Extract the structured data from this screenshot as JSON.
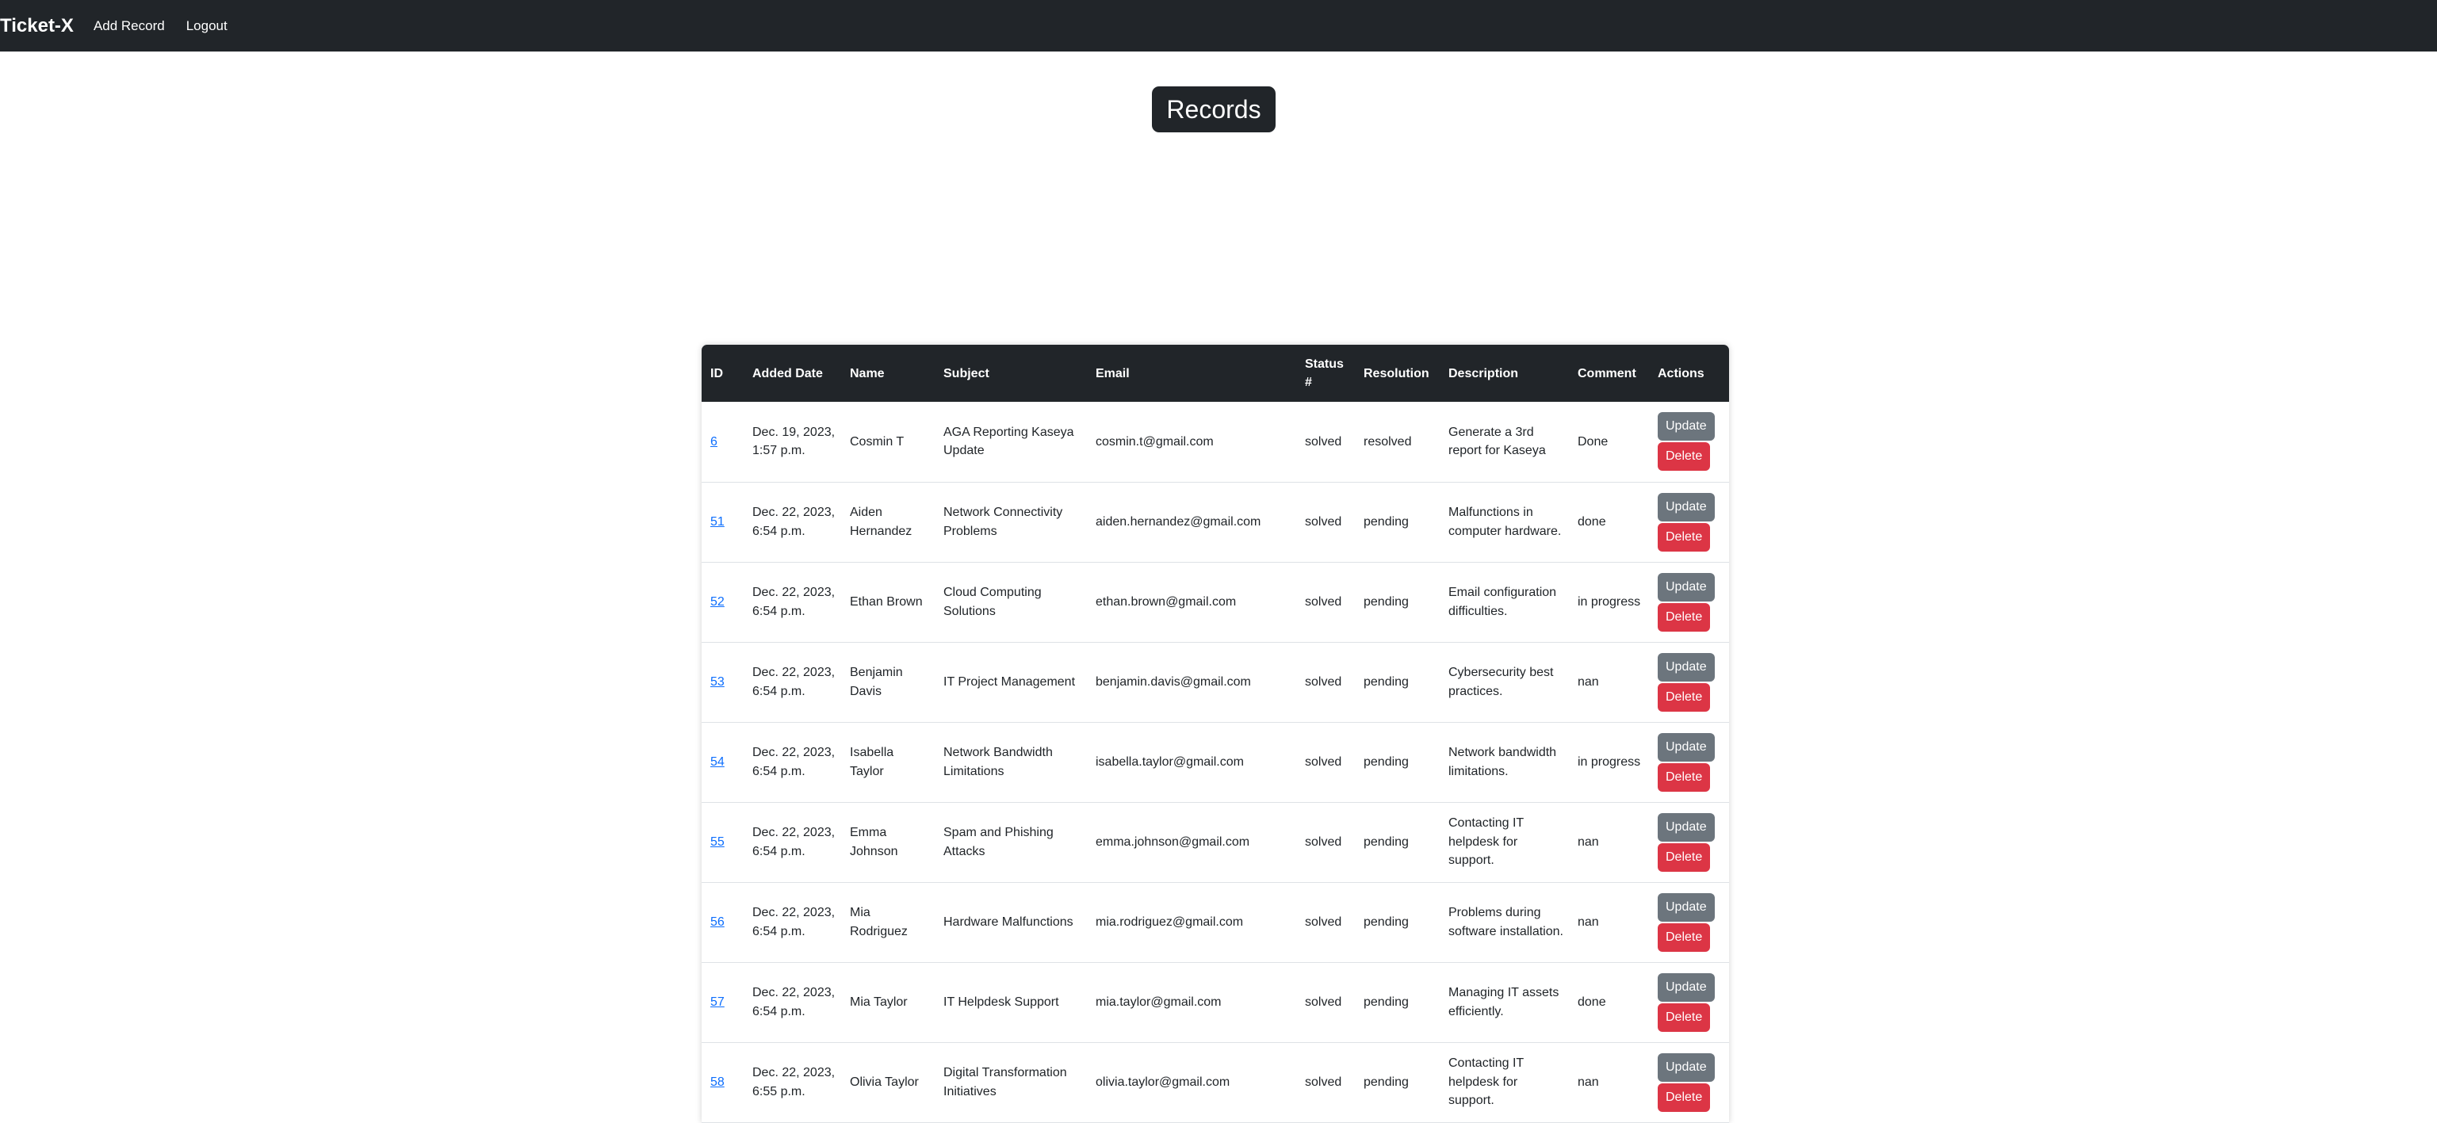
{
  "nav": {
    "brand": "Ticket-X",
    "add_record": "Add Record",
    "logout": "Logout"
  },
  "page": {
    "title": "Records"
  },
  "table": {
    "headers": [
      "ID",
      "Added Date",
      "Name",
      "Subject",
      "Email",
      "Status #",
      "Resolution",
      "Description",
      "Comment",
      "Actions"
    ],
    "update_label": "Update",
    "delete_label": "Delete",
    "rows": [
      {
        "id": "6",
        "date": "Dec. 19, 2023, 1:57 p.m.",
        "name": "Cosmin T",
        "subject": "AGA Reporting Kaseya Update",
        "email": "cosmin.t@gmail.com",
        "status": "solved",
        "resolution": "resolved",
        "description": "Generate a 3rd report for Kaseya",
        "comment": "Done"
      },
      {
        "id": "51",
        "date": "Dec. 22, 2023, 6:54 p.m.",
        "name": "Aiden Hernandez",
        "subject": "Network Connectivity Problems",
        "email": "aiden.hernandez@gmail.com",
        "status": "solved",
        "resolution": "pending",
        "description": "Malfunctions in computer hardware.",
        "comment": "done"
      },
      {
        "id": "52",
        "date": "Dec. 22, 2023, 6:54 p.m.",
        "name": "Ethan Brown",
        "subject": "Cloud Computing Solutions",
        "email": "ethan.brown@gmail.com",
        "status": "solved",
        "resolution": "pending",
        "description": "Email configuration difficulties.",
        "comment": "in progress"
      },
      {
        "id": "53",
        "date": "Dec. 22, 2023, 6:54 p.m.",
        "name": "Benjamin Davis",
        "subject": "IT Project Management",
        "email": "benjamin.davis@gmail.com",
        "status": "solved",
        "resolution": "pending",
        "description": "Cybersecurity best practices.",
        "comment": "nan"
      },
      {
        "id": "54",
        "date": "Dec. 22, 2023, 6:54 p.m.",
        "name": "Isabella Taylor",
        "subject": "Network Bandwidth Limitations",
        "email": "isabella.taylor@gmail.com",
        "status": "solved",
        "resolution": "pending",
        "description": "Network bandwidth limitations.",
        "comment": "in progress"
      },
      {
        "id": "55",
        "date": "Dec. 22, 2023, 6:54 p.m.",
        "name": "Emma Johnson",
        "subject": "Spam and Phishing Attacks",
        "email": "emma.johnson@gmail.com",
        "status": "solved",
        "resolution": "pending",
        "description": "Contacting IT helpdesk for support.",
        "comment": "nan"
      },
      {
        "id": "56",
        "date": "Dec. 22, 2023, 6:54 p.m.",
        "name": "Mia Rodriguez",
        "subject": "Hardware Malfunctions",
        "email": "mia.rodriguez@gmail.com",
        "status": "solved",
        "resolution": "pending",
        "description": "Problems during software installation.",
        "comment": "nan"
      },
      {
        "id": "57",
        "date": "Dec. 22, 2023, 6:54 p.m.",
        "name": "Mia Taylor",
        "subject": "IT Helpdesk Support",
        "email": "mia.taylor@gmail.com",
        "status": "solved",
        "resolution": "pending",
        "description": "Managing IT assets efficiently.",
        "comment": "done"
      },
      {
        "id": "58",
        "date": "Dec. 22, 2023, 6:55 p.m.",
        "name": "Olivia Taylor",
        "subject": "Digital Transformation Initiatives",
        "email": "olivia.taylor@gmail.com",
        "status": "solved",
        "resolution": "pending",
        "description": "Contacting IT helpdesk for support.",
        "comment": "nan"
      }
    ]
  },
  "colors": {
    "navbar": "#212529",
    "link": "#0d6efd",
    "update_button": "#6c757d",
    "delete_button": "#dc3545"
  }
}
